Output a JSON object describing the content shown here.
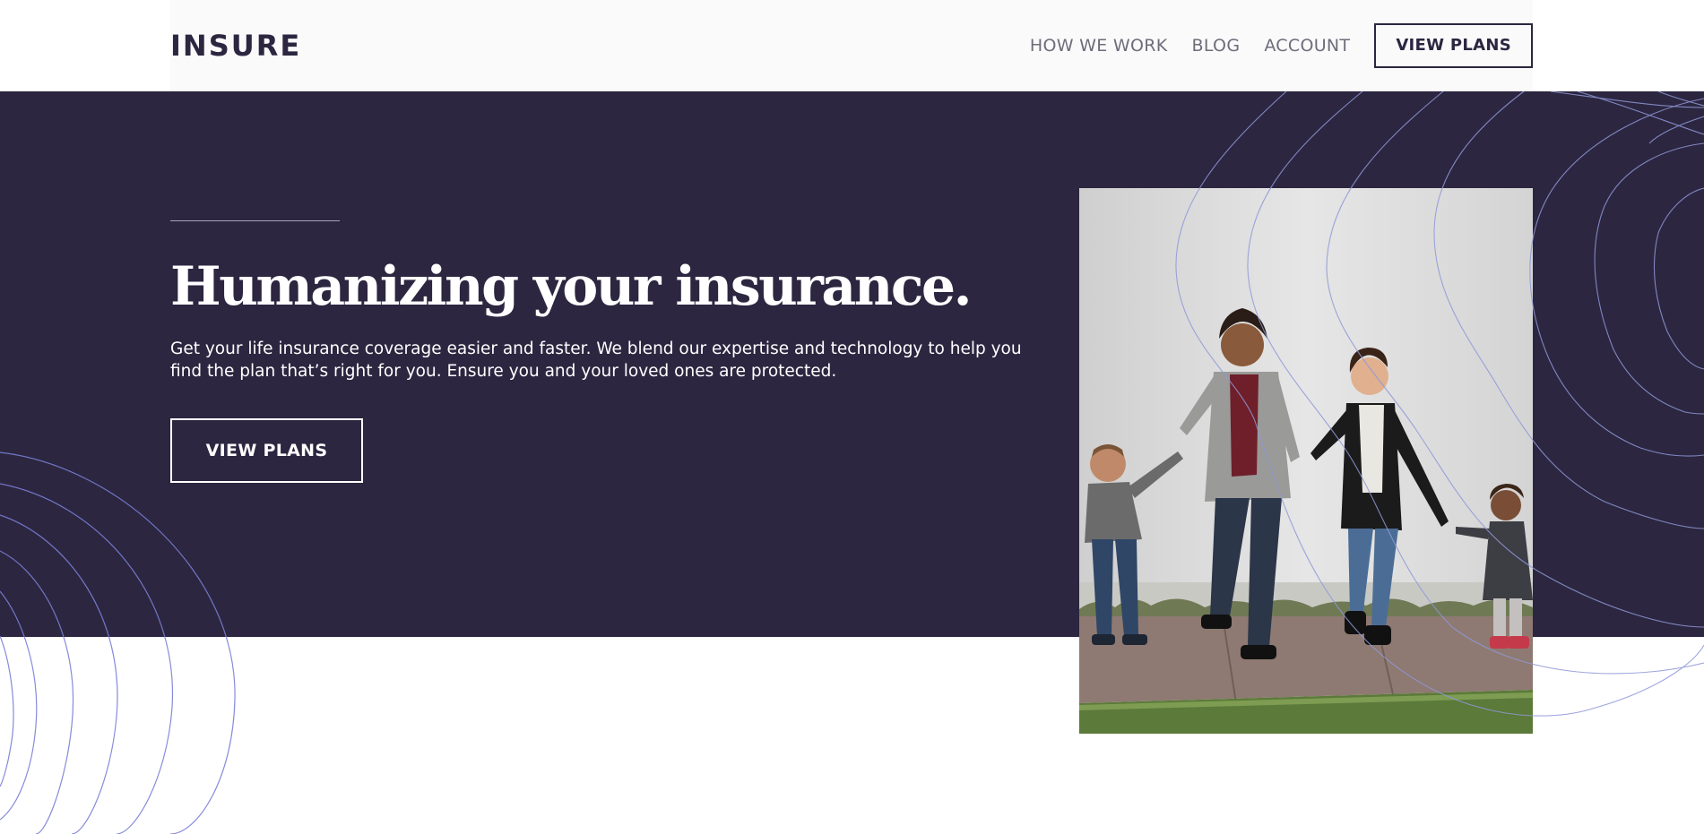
{
  "header": {
    "logo": "INSURE",
    "nav": [
      {
        "label": "HOW WE WORK"
      },
      {
        "label": "BLOG"
      },
      {
        "label": "ACCOUNT"
      }
    ],
    "cta_label": "VIEW PLANS"
  },
  "hero": {
    "title": "Humanizing your insurance.",
    "text": "Get your life insurance coverage easier and faster. We blend our expertise and technology to help you find the plan that’s right for you. Ensure you and your loved ones are protected.",
    "cta_label": "VIEW PLANS"
  },
  "colors": {
    "dark_violet": "#2c2640",
    "grayish_violet": "#6f6c7b",
    "curve_lines": "#7a7fd6",
    "white": "#ffffff"
  },
  "icons": [
    "logo-wordmark",
    "family-photo",
    "decorative-curves"
  ]
}
